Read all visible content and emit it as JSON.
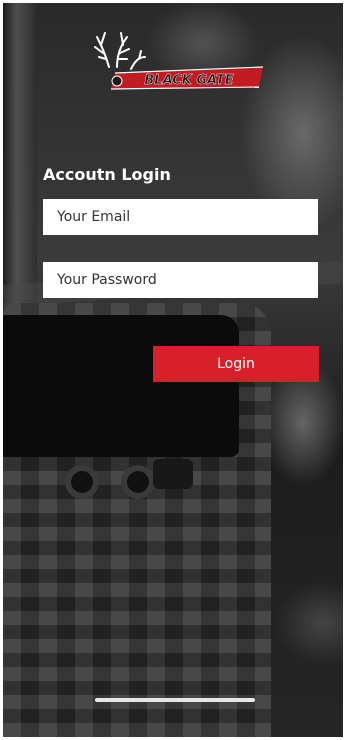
{
  "brand": {
    "logo_text": "BLACK GATE",
    "accent_color": "#d8202a"
  },
  "login": {
    "title": "Accoutn Login",
    "email_placeholder": "Your Email",
    "password_placeholder": "Your Password",
    "button_label": "Login"
  }
}
